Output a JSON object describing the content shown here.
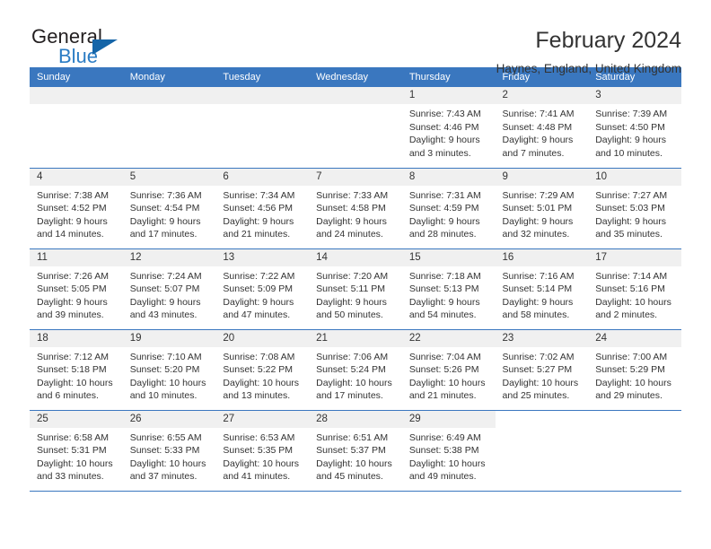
{
  "brand": {
    "name_top": "General",
    "name_bottom": "Blue",
    "triangle_color": "#1565a8",
    "blue_color": "#2b7cc4"
  },
  "header": {
    "title": "February 2024",
    "location": "Haynes, England, United Kingdom"
  },
  "theme": {
    "header_blue": "#3a77bf",
    "band_gray": "#f0f0f0",
    "text": "#333333"
  },
  "weekdays": [
    "Sunday",
    "Monday",
    "Tuesday",
    "Wednesday",
    "Thursday",
    "Friday",
    "Saturday"
  ],
  "labels": {
    "sunrise_prefix": "Sunrise:",
    "sunset_prefix": "Sunset:",
    "daylight_prefix": "Daylight:"
  },
  "weeks": [
    [
      {
        "day": "",
        "sunrise": "",
        "sunset": "",
        "daylight_line1": "",
        "daylight_line2": "",
        "empty": true
      },
      {
        "day": "",
        "sunrise": "",
        "sunset": "",
        "daylight_line1": "",
        "daylight_line2": "",
        "empty": true
      },
      {
        "day": "",
        "sunrise": "",
        "sunset": "",
        "daylight_line1": "",
        "daylight_line2": "",
        "empty": true
      },
      {
        "day": "",
        "sunrise": "",
        "sunset": "",
        "daylight_line1": "",
        "daylight_line2": "",
        "empty": true
      },
      {
        "day": "1",
        "sunrise": "Sunrise: 7:43 AM",
        "sunset": "Sunset: 4:46 PM",
        "daylight_line1": "Daylight: 9 hours",
        "daylight_line2": "and 3 minutes."
      },
      {
        "day": "2",
        "sunrise": "Sunrise: 7:41 AM",
        "sunset": "Sunset: 4:48 PM",
        "daylight_line1": "Daylight: 9 hours",
        "daylight_line2": "and 7 minutes."
      },
      {
        "day": "3",
        "sunrise": "Sunrise: 7:39 AM",
        "sunset": "Sunset: 4:50 PM",
        "daylight_line1": "Daylight: 9 hours",
        "daylight_line2": "and 10 minutes."
      }
    ],
    [
      {
        "day": "4",
        "sunrise": "Sunrise: 7:38 AM",
        "sunset": "Sunset: 4:52 PM",
        "daylight_line1": "Daylight: 9 hours",
        "daylight_line2": "and 14 minutes."
      },
      {
        "day": "5",
        "sunrise": "Sunrise: 7:36 AM",
        "sunset": "Sunset: 4:54 PM",
        "daylight_line1": "Daylight: 9 hours",
        "daylight_line2": "and 17 minutes."
      },
      {
        "day": "6",
        "sunrise": "Sunrise: 7:34 AM",
        "sunset": "Sunset: 4:56 PM",
        "daylight_line1": "Daylight: 9 hours",
        "daylight_line2": "and 21 minutes."
      },
      {
        "day": "7",
        "sunrise": "Sunrise: 7:33 AM",
        "sunset": "Sunset: 4:58 PM",
        "daylight_line1": "Daylight: 9 hours",
        "daylight_line2": "and 24 minutes."
      },
      {
        "day": "8",
        "sunrise": "Sunrise: 7:31 AM",
        "sunset": "Sunset: 4:59 PM",
        "daylight_line1": "Daylight: 9 hours",
        "daylight_line2": "and 28 minutes."
      },
      {
        "day": "9",
        "sunrise": "Sunrise: 7:29 AM",
        "sunset": "Sunset: 5:01 PM",
        "daylight_line1": "Daylight: 9 hours",
        "daylight_line2": "and 32 minutes."
      },
      {
        "day": "10",
        "sunrise": "Sunrise: 7:27 AM",
        "sunset": "Sunset: 5:03 PM",
        "daylight_line1": "Daylight: 9 hours",
        "daylight_line2": "and 35 minutes."
      }
    ],
    [
      {
        "day": "11",
        "sunrise": "Sunrise: 7:26 AM",
        "sunset": "Sunset: 5:05 PM",
        "daylight_line1": "Daylight: 9 hours",
        "daylight_line2": "and 39 minutes."
      },
      {
        "day": "12",
        "sunrise": "Sunrise: 7:24 AM",
        "sunset": "Sunset: 5:07 PM",
        "daylight_line1": "Daylight: 9 hours",
        "daylight_line2": "and 43 minutes."
      },
      {
        "day": "13",
        "sunrise": "Sunrise: 7:22 AM",
        "sunset": "Sunset: 5:09 PM",
        "daylight_line1": "Daylight: 9 hours",
        "daylight_line2": "and 47 minutes."
      },
      {
        "day": "14",
        "sunrise": "Sunrise: 7:20 AM",
        "sunset": "Sunset: 5:11 PM",
        "daylight_line1": "Daylight: 9 hours",
        "daylight_line2": "and 50 minutes."
      },
      {
        "day": "15",
        "sunrise": "Sunrise: 7:18 AM",
        "sunset": "Sunset: 5:13 PM",
        "daylight_line1": "Daylight: 9 hours",
        "daylight_line2": "and 54 minutes."
      },
      {
        "day": "16",
        "sunrise": "Sunrise: 7:16 AM",
        "sunset": "Sunset: 5:14 PM",
        "daylight_line1": "Daylight: 9 hours",
        "daylight_line2": "and 58 minutes."
      },
      {
        "day": "17",
        "sunrise": "Sunrise: 7:14 AM",
        "sunset": "Sunset: 5:16 PM",
        "daylight_line1": "Daylight: 10 hours",
        "daylight_line2": "and 2 minutes."
      }
    ],
    [
      {
        "day": "18",
        "sunrise": "Sunrise: 7:12 AM",
        "sunset": "Sunset: 5:18 PM",
        "daylight_line1": "Daylight: 10 hours",
        "daylight_line2": "and 6 minutes."
      },
      {
        "day": "19",
        "sunrise": "Sunrise: 7:10 AM",
        "sunset": "Sunset: 5:20 PM",
        "daylight_line1": "Daylight: 10 hours",
        "daylight_line2": "and 10 minutes."
      },
      {
        "day": "20",
        "sunrise": "Sunrise: 7:08 AM",
        "sunset": "Sunset: 5:22 PM",
        "daylight_line1": "Daylight: 10 hours",
        "daylight_line2": "and 13 minutes."
      },
      {
        "day": "21",
        "sunrise": "Sunrise: 7:06 AM",
        "sunset": "Sunset: 5:24 PM",
        "daylight_line1": "Daylight: 10 hours",
        "daylight_line2": "and 17 minutes."
      },
      {
        "day": "22",
        "sunrise": "Sunrise: 7:04 AM",
        "sunset": "Sunset: 5:26 PM",
        "daylight_line1": "Daylight: 10 hours",
        "daylight_line2": "and 21 minutes."
      },
      {
        "day": "23",
        "sunrise": "Sunrise: 7:02 AM",
        "sunset": "Sunset: 5:27 PM",
        "daylight_line1": "Daylight: 10 hours",
        "daylight_line2": "and 25 minutes."
      },
      {
        "day": "24",
        "sunrise": "Sunrise: 7:00 AM",
        "sunset": "Sunset: 5:29 PM",
        "daylight_line1": "Daylight: 10 hours",
        "daylight_line2": "and 29 minutes."
      }
    ],
    [
      {
        "day": "25",
        "sunrise": "Sunrise: 6:58 AM",
        "sunset": "Sunset: 5:31 PM",
        "daylight_line1": "Daylight: 10 hours",
        "daylight_line2": "and 33 minutes."
      },
      {
        "day": "26",
        "sunrise": "Sunrise: 6:55 AM",
        "sunset": "Sunset: 5:33 PM",
        "daylight_line1": "Daylight: 10 hours",
        "daylight_line2": "and 37 minutes."
      },
      {
        "day": "27",
        "sunrise": "Sunrise: 6:53 AM",
        "sunset": "Sunset: 5:35 PM",
        "daylight_line1": "Daylight: 10 hours",
        "daylight_line2": "and 41 minutes."
      },
      {
        "day": "28",
        "sunrise": "Sunrise: 6:51 AM",
        "sunset": "Sunset: 5:37 PM",
        "daylight_line1": "Daylight: 10 hours",
        "daylight_line2": "and 45 minutes."
      },
      {
        "day": "29",
        "sunrise": "Sunrise: 6:49 AM",
        "sunset": "Sunset: 5:38 PM",
        "daylight_line1": "Daylight: 10 hours",
        "daylight_line2": "and 49 minutes."
      },
      {
        "day": "",
        "sunrise": "",
        "sunset": "",
        "daylight_line1": "",
        "daylight_line2": "",
        "blank": true
      },
      {
        "day": "",
        "sunrise": "",
        "sunset": "",
        "daylight_line1": "",
        "daylight_line2": "",
        "blank": true
      }
    ]
  ]
}
